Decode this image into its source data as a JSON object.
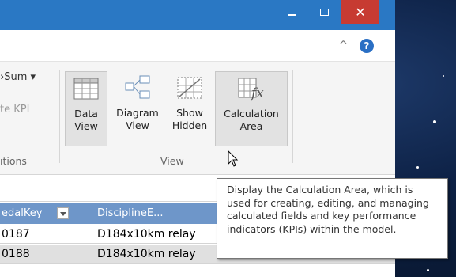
{
  "window": {
    "close_glyph": "✕"
  },
  "ribbon": {
    "collapse_glyph": "^",
    "help_glyph": "?",
    "autosum_label": "›Sum ▾",
    "create_kpi_label": "te KPI",
    "calculations_group_label": "ıtions",
    "view_group_label": "View",
    "buttons": [
      {
        "label_line1": "Data",
        "label_line2": "View",
        "icon": "data-view-icon"
      },
      {
        "label_line1": "Diagram",
        "label_line2": "View",
        "icon": "diagram-view-icon"
      },
      {
        "label_line1": "Show",
        "label_line2": "Hidden",
        "icon": "show-hidden-icon"
      },
      {
        "label_line1": "Calculation",
        "label_line2": "Area",
        "icon": "calculation-area-icon"
      }
    ]
  },
  "grid": {
    "columns": [
      "edalKey",
      "DisciplineE..."
    ],
    "rows": [
      [
        "0187",
        "D184x10km relay"
      ],
      [
        "0188",
        "D184x10km relay"
      ]
    ]
  },
  "tooltip": {
    "text": "Display the Calculation Area, which is used for creating, editing, and managing calculated fields and key performance indicators (KPIs) within the model."
  },
  "colors": {
    "titlebar": "#2a78c4",
    "close_button": "#c73b32",
    "grid_header": "#6e96c9"
  }
}
